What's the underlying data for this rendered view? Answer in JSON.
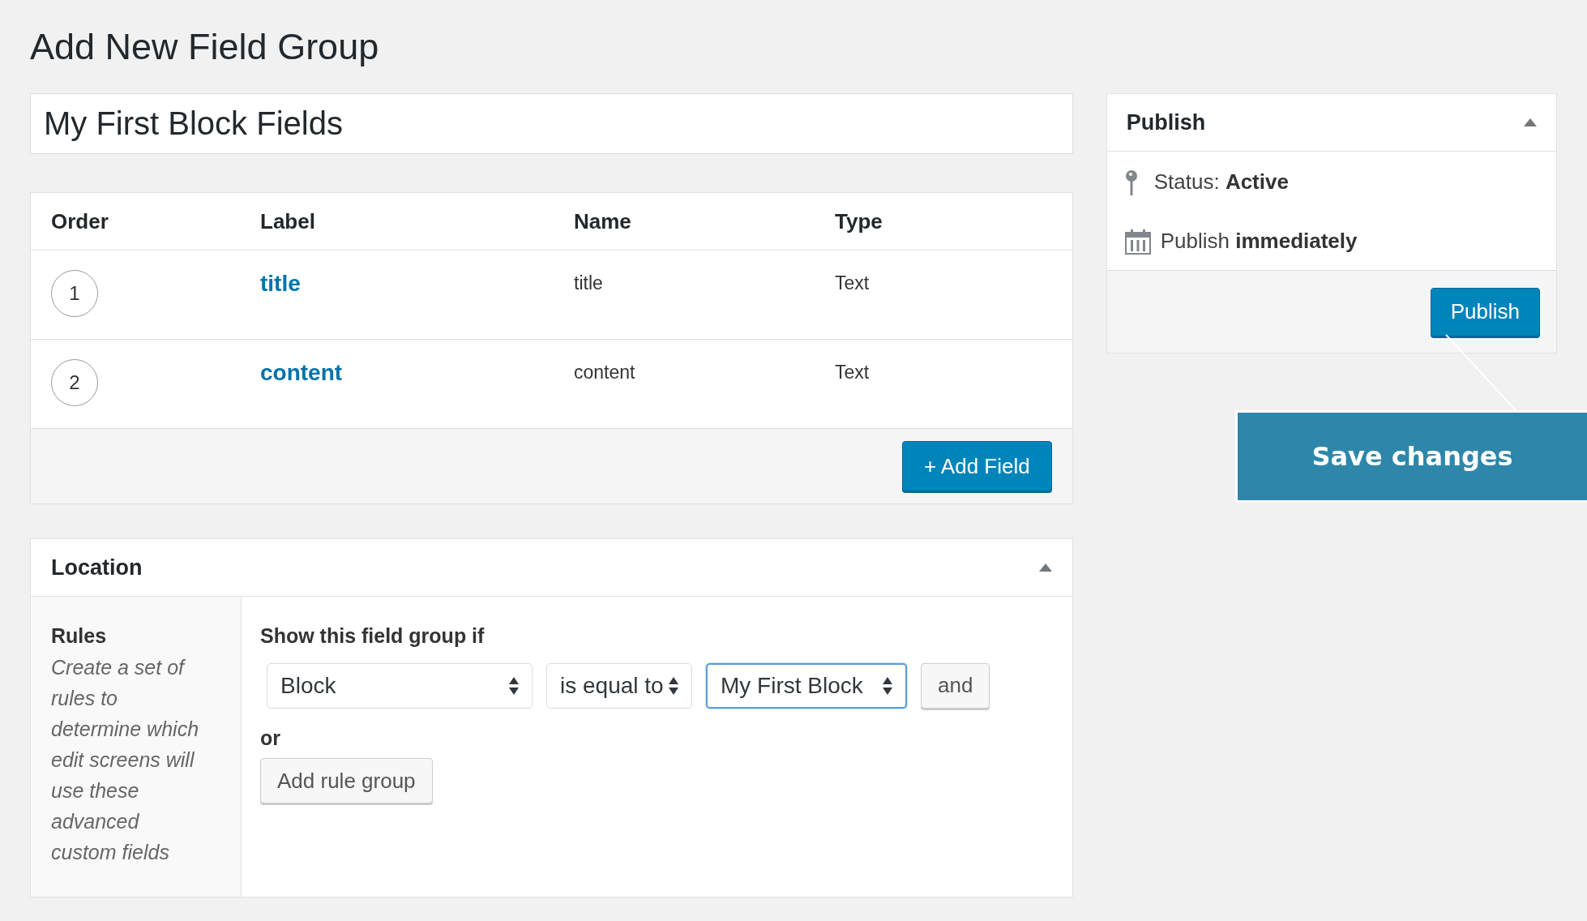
{
  "page_title": "Add New Field Group",
  "title_field": {
    "value": "My First Block Fields"
  },
  "fields_table": {
    "columns": [
      "Order",
      "Label",
      "Name",
      "Type"
    ],
    "rows": [
      {
        "order": "1",
        "label": "title",
        "name": "title",
        "type": "Text"
      },
      {
        "order": "2",
        "label": "content",
        "name": "content",
        "type": "Text"
      }
    ],
    "add_button": "+ Add Field"
  },
  "location": {
    "title": "Location",
    "expanded": true,
    "rules_title": "Rules",
    "rules_help": "Create a set of rules to determine which edit screens will use these advanced custom fields",
    "condition_label": "Show this field group if",
    "selects": [
      {
        "value": "Block",
        "focused": false
      },
      {
        "value": "is equal to",
        "focused": false
      },
      {
        "value": "My First Block",
        "focused": true
      }
    ],
    "and_button": "and",
    "or_label": "or",
    "add_group_button": "Add rule group"
  },
  "publish": {
    "title": "Publish",
    "expanded": true,
    "status": {
      "label": "Status:",
      "value": "Active"
    },
    "schedule": {
      "label": "Publish",
      "value": "immediately"
    },
    "button": "Publish"
  },
  "callout": {
    "text": "Save changes"
  }
}
